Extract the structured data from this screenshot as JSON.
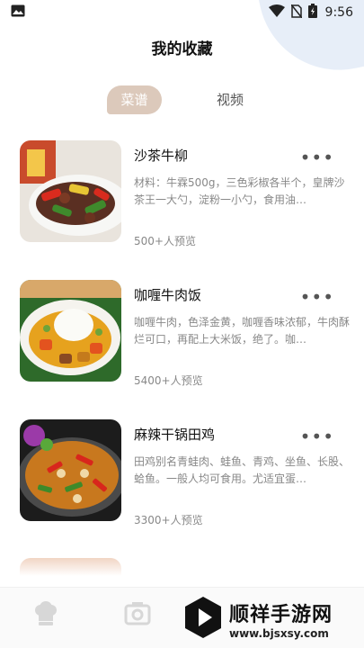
{
  "status": {
    "time": "9:56"
  },
  "page": {
    "title": "我的收藏"
  },
  "tabs": [
    {
      "label": "菜谱"
    },
    {
      "label": "视频"
    }
  ],
  "recipes": [
    {
      "title": "沙茶牛柳",
      "desc": "材料：牛霖500g，三色彩椒各半个，皇牌沙茶王一大勺，淀粉一小勺，食用油…",
      "views": "500+人预览"
    },
    {
      "title": "咖喱牛肉饭",
      "desc": "咖喱牛肉，色泽金黄，咖喱香味浓郁，牛肉酥烂可口，再配上大米饭，绝了。咖…",
      "views": "5400+人预览"
    },
    {
      "title": "麻辣干锅田鸡",
      "desc": "田鸡别名青蛙肉、蛙鱼、青鸡、坐鱼、长股、蛤鱼。一般人均可食用。尤适宜蛋…",
      "views": "3300+人预览"
    }
  ],
  "more_glyph": "•••",
  "watermark": {
    "name": "顺祥手游网",
    "url": "www.bjsxsy.com"
  },
  "icons": [
    "image-icon",
    "wifi-icon",
    "no-sim-icon",
    "battery-icon",
    "chef-hat-icon",
    "video-icon",
    "play-logo-icon"
  ]
}
